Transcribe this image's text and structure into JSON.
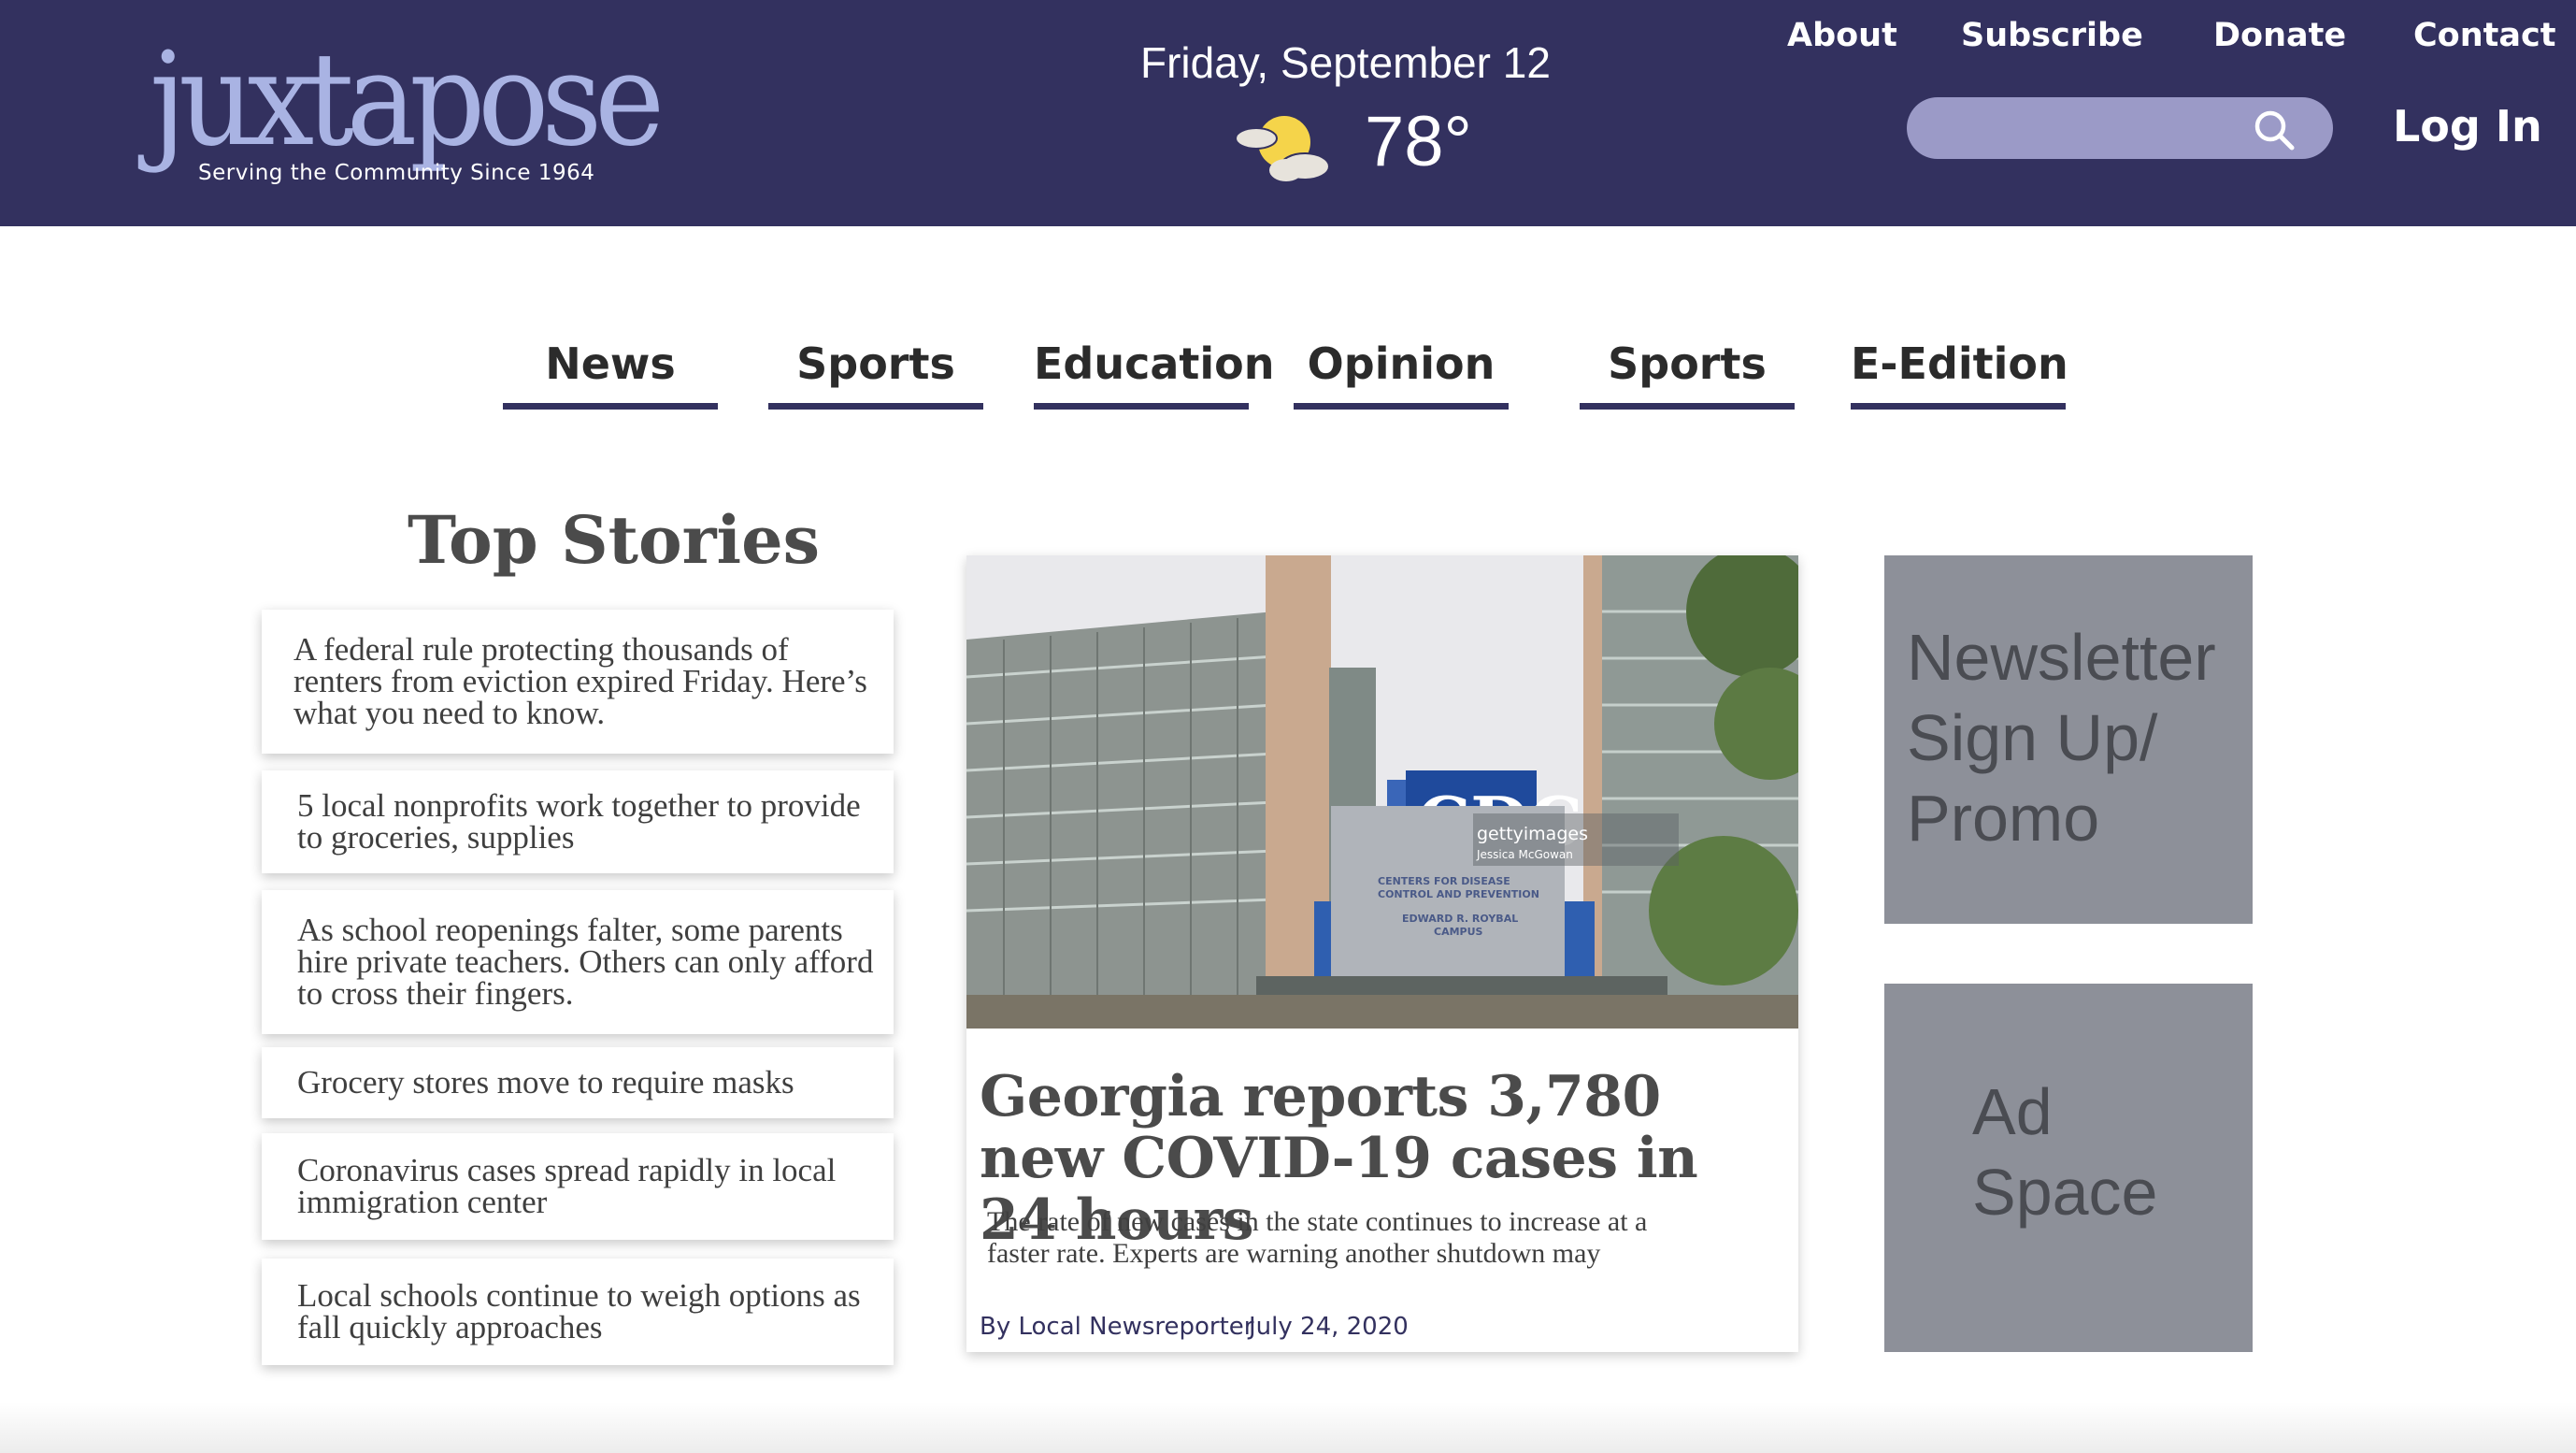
{
  "site": {
    "logo_text": "juxtapose",
    "tagline": "Serving the Community Since 1964"
  },
  "header": {
    "date": "Friday, September 12",
    "weather_icon": "partly-cloudy-icon",
    "temperature": "78°",
    "links": [
      "About",
      "Subscribe",
      "Donate",
      "Contact"
    ],
    "search": {
      "placeholder": "",
      "icon": "search-icon"
    },
    "login": "Log In"
  },
  "nav": {
    "items": [
      "News",
      "Sports",
      "Education",
      "Opinion",
      "Sports",
      "E-Edition"
    ]
  },
  "top_stories": {
    "title": "Top Stories",
    "items": [
      "A federal rule protecting thousands of  renters from eviction expired Friday. Here’s what you need to know.",
      "5 local nonprofits work together to provide to groceries, supplies",
      "As school reopenings falter, some parents  hire private teachers. Others can only afford to cross their fingers.",
      "Grocery stores move to require masks",
      "Coronavirus cases spread rapidly in local immigration center",
      "Local schools continue to weigh options as fall quickly approaches"
    ]
  },
  "feature": {
    "photo": {
      "sign_text": "CDC",
      "watermark": "gettyimages",
      "credit": "Jessica McGowan",
      "sign_line1": "CENTERS FOR DISEASE",
      "sign_line2": "CONTROL AND PREVENTION",
      "sign_line3": "EDWARD R. ROYBAL",
      "sign_line4": "CAMPUS"
    },
    "headline": "Georgia reports 3,780 new COVID-19 cases in 24 hours",
    "dek": "The rate of new cases in the state continues to increase at a faster rate. Experts are warning another shutdown may",
    "byline": "By Local Newsreporter",
    "date": "July 24, 2020"
  },
  "sidebar": {
    "promo": "Newsletter Sign Up/ Promo",
    "ad": "Ad Space"
  },
  "colors": {
    "header_bg": "#33315f",
    "logo": "#a9b3e3",
    "search_bg": "#9b9ac7",
    "sidebox_bg": "#8d9099"
  }
}
